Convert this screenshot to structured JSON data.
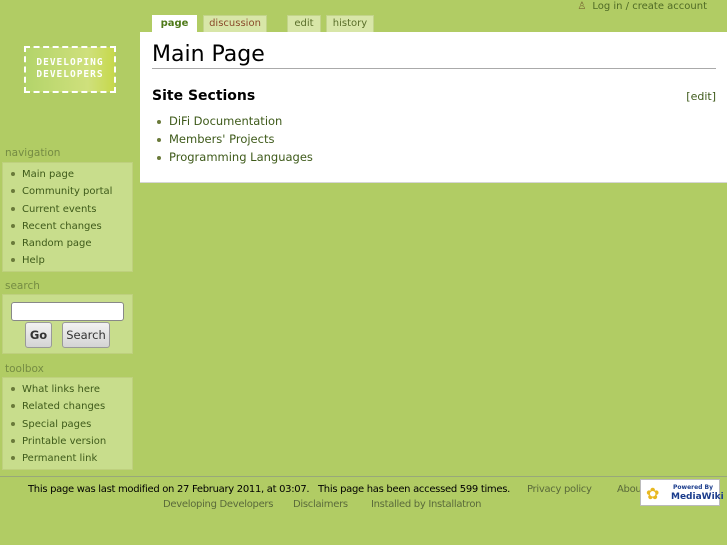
{
  "user": {
    "login_label": "Log in / create account",
    "icon": "user-icon"
  },
  "tabs": [
    {
      "label": "page"
    },
    {
      "label": "discussion"
    },
    {
      "label": "edit"
    },
    {
      "label": "history"
    }
  ],
  "logo": {
    "line1": "DEVELOPING",
    "line2": "DEVELOPERS"
  },
  "content": {
    "title": "Main Page",
    "section": "Site Sections",
    "edit_label": "[edit]",
    "items": [
      "DiFi Documentation",
      "Members' Projects",
      "Programming Languages"
    ]
  },
  "navigation": {
    "label": "navigation",
    "items": [
      "Main page",
      "Community portal",
      "Current events",
      "Recent changes",
      "Random page",
      "Help"
    ]
  },
  "search": {
    "label": "search",
    "value": "",
    "go_label": "Go",
    "search_label": "Search"
  },
  "toolbox": {
    "label": "toolbox",
    "items": [
      "What links here",
      "Related changes",
      "Special pages",
      "Printable version",
      "Permanent link"
    ]
  },
  "footer": {
    "modified": "This page was last modified on 27 February 2011, at 03:07.",
    "accessed": "This page has been accessed 599 times.",
    "privacy": "Privacy policy",
    "about": "About",
    "site": "Developing Developers",
    "disclaimers": "Disclaimers",
    "installed": "Installed by Installatron",
    "powered_by": "Powered By",
    "mediawiki": "MediaWiki"
  },
  "colors": {
    "background": "#b1cc64",
    "link": "#3e5a1a",
    "portlet": "#c8dd8c"
  }
}
